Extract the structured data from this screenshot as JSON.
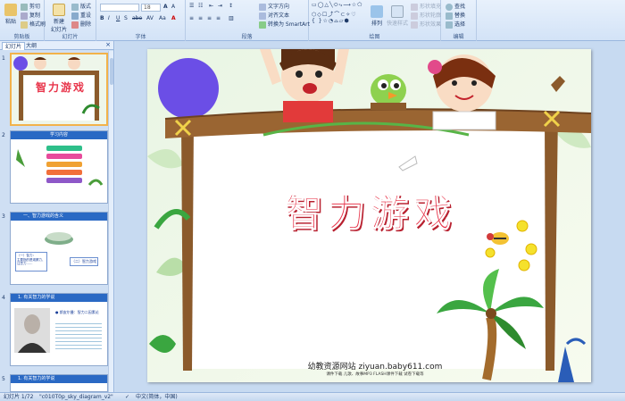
{
  "ribbon": {
    "clipboard": {
      "paste": "粘贴",
      "cut": "剪切",
      "copy": "复制",
      "format_painter": "格式刷",
      "label": "剪贴板"
    },
    "slides": {
      "new_slide": "新建\n幻灯片",
      "layout": "版式",
      "reset": "重设",
      "delete": "删除",
      "label": "幻灯片"
    },
    "font": {
      "size": "18",
      "label": "字体"
    },
    "paragraph": {
      "text_direction": "文字方向",
      "align_text": "对齐文本",
      "smartart": "转换为 SmartArt",
      "label": "段落"
    },
    "drawing": {
      "arrange": "排列",
      "quick_styles": "快速样式",
      "shape_fill": "形状填充",
      "shape_outline": "形状轮廓",
      "shape_effects": "形状效果",
      "label": "绘图"
    },
    "editing": {
      "find": "查找",
      "replace": "替换",
      "select": "选择",
      "label": "编辑"
    }
  },
  "leftpane": {
    "tab_slides": "幻灯片",
    "tab_outline": "大纲",
    "close": "×",
    "thumbs": [
      {
        "num": "1",
        "title": "智力游戏"
      },
      {
        "num": "2",
        "title": "学习内容"
      },
      {
        "num": "3",
        "title": "一、智力游戏的含义",
        "box1": "（一）智力：\n主要指的是观察力、注意力……",
        "box2": "（二）智力游戏"
      },
      {
        "num": "4",
        "title": "1. 有关智力的学说",
        "bullet": "● 斯皮尔曼：智力二因素论"
      },
      {
        "num": "5",
        "title": "1. 有关智力的学说"
      }
    ]
  },
  "slide": {
    "title": "智力游戏",
    "site": "幼教资源网站  ziyuan.baby611.com",
    "subtitle": "课件下载  儿歌、故事MP3  FLASH课件下载  试卷下载等"
  },
  "status": {
    "slide_info": "幻灯片 1/72",
    "theme": "\"c010T0p_sky_diagram_v2\"",
    "language": "中文(简体，中国)"
  },
  "colors": {
    "title_red": "#e8344a",
    "purple_circle": "#6b4ee6",
    "frame_brown": "#8b5a2b",
    "thumb_selected": "#f2b24a"
  }
}
